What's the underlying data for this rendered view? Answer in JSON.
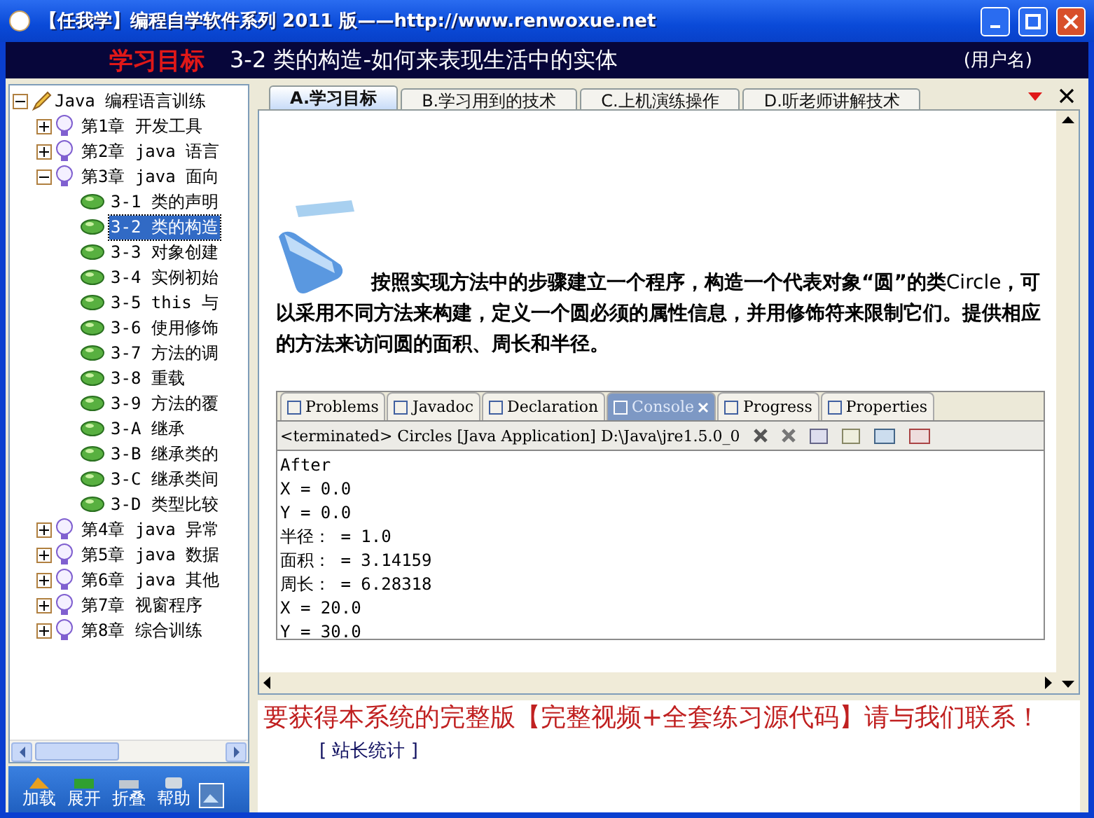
{
  "window": {
    "title": "【任我学】编程自学软件系列 2011 版——http://www.renwoxue.net"
  },
  "header": {
    "section": "学习目标",
    "lesson": "3-2 类的构造-如何来表现生活中的实体",
    "user": "(用户名)"
  },
  "tree": {
    "label": "Java 编程语言训练",
    "expanded": true,
    "children": [
      {
        "label": "第1章 开发工具",
        "expanded": false,
        "selected": false
      },
      {
        "label": "第2章 java 语言",
        "expanded": false,
        "selected": false
      },
      {
        "label": "第3章 java 面向",
        "expanded": true,
        "selected": false,
        "children": [
          {
            "label": "3-1 类的声明",
            "selected": false
          },
          {
            "label": "3-2 类的构造",
            "selected": true
          },
          {
            "label": "3-3 对象创建",
            "selected": false
          },
          {
            "label": "3-4 实例初始",
            "selected": false
          },
          {
            "label": "3-5 this 与",
            "selected": false
          },
          {
            "label": "3-6 使用修饰",
            "selected": false
          },
          {
            "label": "3-7 方法的调",
            "selected": false
          },
          {
            "label": "3-8 重载",
            "selected": false
          },
          {
            "label": "3-9 方法的覆",
            "selected": false
          },
          {
            "label": "3-A 继承",
            "selected": false
          },
          {
            "label": "3-B 继承类的",
            "selected": false
          },
          {
            "label": "3-C 继承类间",
            "selected": false
          },
          {
            "label": "3-D 类型比较",
            "selected": false
          }
        ]
      },
      {
        "label": "第4章 java 异常",
        "expanded": false,
        "selected": false
      },
      {
        "label": "第5章 java 数据",
        "expanded": false,
        "selected": false
      },
      {
        "label": "第6章 java 其他",
        "expanded": false,
        "selected": false
      },
      {
        "label": "第7章 视窗程序",
        "expanded": false,
        "selected": false
      },
      {
        "label": "第8章 综合训练",
        "expanded": false,
        "selected": false
      }
    ]
  },
  "toolbar": [
    {
      "label": "加载",
      "kind": "load"
    },
    {
      "label": "展开",
      "kind": "expand"
    },
    {
      "label": "折叠",
      "kind": "collapse"
    },
    {
      "label": "帮助",
      "kind": "help"
    }
  ],
  "tabs": [
    {
      "label": "A.学习目标",
      "selected": true
    },
    {
      "label": "B.学习用到的技术",
      "selected": false
    },
    {
      "label": "C.上机演练操作",
      "selected": false
    },
    {
      "label": "D.听老师讲解技术",
      "selected": false
    }
  ],
  "content": {
    "paragraph": "**按照实现方法中的步骤建立一个程序，构造一个代表对象“圆”的类**Circle**，可以采用不同方法来构建，定义一个圆必须的属性信息，并用修饰符来限制它们。提供相应的方法来访问圆的面积、周长和半径。**",
    "console": {
      "tabs": [
        {
          "label": "Problems",
          "selected": false
        },
        {
          "label": "Javadoc",
          "selected": false
        },
        {
          "label": "Declaration",
          "selected": false
        },
        {
          "label": "Console",
          "selected": true
        },
        {
          "label": "Progress",
          "selected": false
        },
        {
          "label": "Properties",
          "selected": false
        }
      ],
      "status": "<terminated> Circles [Java Application] D:\\Java\\jre1.5.0_0",
      "lines": [
        "After",
        "X = 0.0",
        "Y = 0.0",
        "半径： = 1.0",
        "面积： = 3.14159",
        "周长： = 6.28318",
        "X = 20.0",
        "Y = 30.0"
      ]
    }
  },
  "footer": {
    "message": "要获得本系统的完整版【完整视频+全套练习源代码】请与我们联系！",
    "link": "[ 站长统计 ]"
  }
}
